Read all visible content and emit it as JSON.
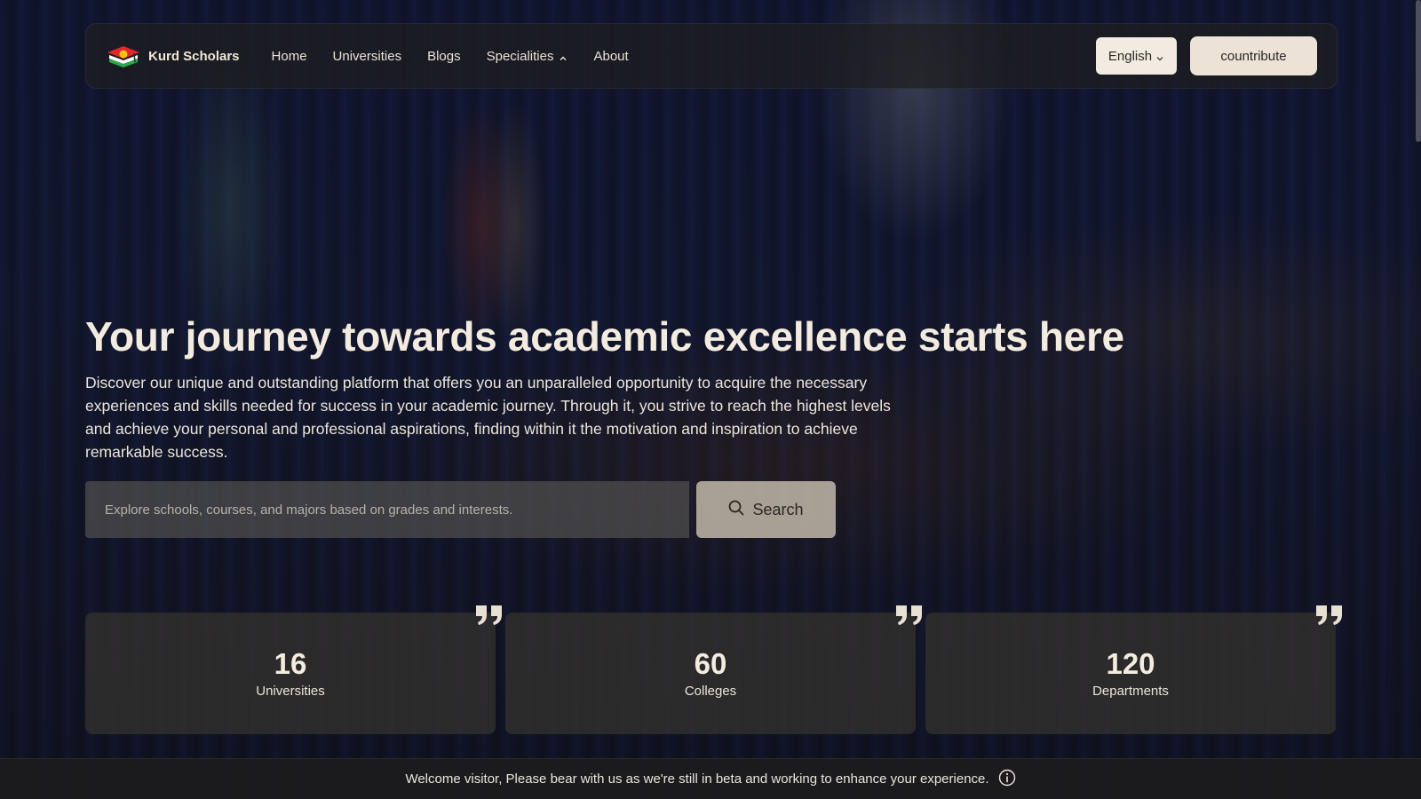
{
  "brand": {
    "name": "Kurd Scholars",
    "logo_icon": "kurdistan-flag-cap-icon"
  },
  "nav": {
    "links": [
      {
        "label": "Home"
      },
      {
        "label": "Universities"
      },
      {
        "label": "Blogs"
      },
      {
        "label": "Specialities",
        "has_dropdown": true
      },
      {
        "label": "About"
      }
    ],
    "language": "English",
    "contribute_label": "countribute"
  },
  "hero": {
    "title": "Your journey towards academic excellence starts here",
    "description": "Discover our unique and outstanding platform that offers you an unparalleled opportunity to acquire the necessary experiences and skills needed for success in your academic journey. Through it, you strive to reach the highest levels and achieve your personal and professional aspirations, finding within it the motivation and inspiration to achieve remarkable success."
  },
  "search": {
    "placeholder": "Explore schools, courses, and majors based on grades and interests.",
    "button_label": "Search",
    "button_icon": "search-icon"
  },
  "stats": [
    {
      "value": "16",
      "label": "Universities"
    },
    {
      "value": "60",
      "label": "Colleges"
    },
    {
      "value": "120",
      "label": "Departments"
    }
  ],
  "beta_banner": {
    "text": "Welcome visitor, Please bear with us as we're still in beta and working to enhance your experience.",
    "icon": "info-icon"
  },
  "colors": {
    "accent_button": "#ece3d6",
    "card_bg": "#32302d",
    "text_light": "#f1e9dc"
  }
}
